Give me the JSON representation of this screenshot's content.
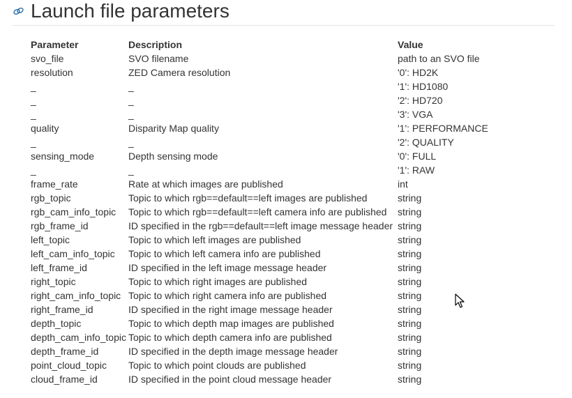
{
  "page": {
    "title": "Launch file parameters"
  },
  "table": {
    "headers": [
      "Parameter",
      "Description",
      "Value"
    ],
    "rows": [
      {
        "param": "svo_file",
        "desc": "SVO filename",
        "value": "path to an SVO file"
      },
      {
        "param": "resolution",
        "desc": "ZED Camera resolution",
        "value": "'0': HD2K"
      },
      {
        "param": "_",
        "desc": "_",
        "value": "'1': HD1080"
      },
      {
        "param": "_",
        "desc": "_",
        "value": "'2': HD720"
      },
      {
        "param": "_",
        "desc": "_",
        "value": "'3': VGA"
      },
      {
        "param": "quality",
        "desc": "Disparity Map quality",
        "value": "'1': PERFORMANCE"
      },
      {
        "param": "_",
        "desc": "_",
        "value": "'2': QUALITY"
      },
      {
        "param": "sensing_mode",
        "desc": "Depth sensing mode",
        "value": "'0': FULL"
      },
      {
        "param": "_",
        "desc": "_",
        "value": "'1': RAW"
      },
      {
        "param": "frame_rate",
        "desc": "Rate at which images are published",
        "value": "int"
      },
      {
        "param": "rgb_topic",
        "desc": "Topic to which rgb==default==left images are published",
        "value": "string"
      },
      {
        "param": "rgb_cam_info_topic",
        "desc": "Topic to which rgb==default==left camera info are published",
        "value": "string"
      },
      {
        "param": "rgb_frame_id",
        "desc": "ID specified in the rgb==default==left image message header",
        "value": "string"
      },
      {
        "param": "left_topic",
        "desc": "Topic to which left images are published",
        "value": "string"
      },
      {
        "param": "left_cam_info_topic",
        "desc": "Topic to which left camera info are published",
        "value": "string"
      },
      {
        "param": "left_frame_id",
        "desc": "ID specified in the left image message header",
        "value": "string"
      },
      {
        "param": "right_topic",
        "desc": "Topic to which right images are published",
        "value": "string"
      },
      {
        "param": "right_cam_info_topic",
        "desc": "Topic to which right camera info are published",
        "value": "string"
      },
      {
        "param": "right_frame_id",
        "desc": "ID specified in the right image message header",
        "value": "string"
      },
      {
        "param": "depth_topic",
        "desc": "Topic to which depth map images are published",
        "value": "string"
      },
      {
        "param": "depth_cam_info_topic",
        "desc": "Topic to which depth camera info are published",
        "value": "string"
      },
      {
        "param": "depth_frame_id",
        "desc": "ID specified in the depth image message header",
        "value": "string"
      },
      {
        "param": "point_cloud_topic",
        "desc": "Topic to which point clouds are published",
        "value": "string"
      },
      {
        "param": "cloud_frame_id",
        "desc": "ID specified in the point cloud message header",
        "value": "string"
      }
    ]
  },
  "icons": {
    "anchor": "link-icon",
    "cursor": "mouse-pointer-icon"
  },
  "colors": {
    "text": "#333333",
    "anchor_icon": "#2a6fa8",
    "rule": "#e5e5e5"
  }
}
